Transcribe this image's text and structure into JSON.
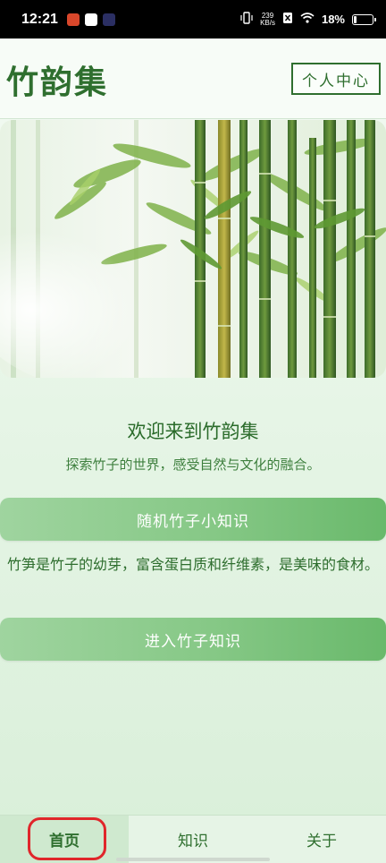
{
  "status_bar": {
    "time": "12:21",
    "net_speed_value": "239",
    "net_speed_unit": "KB/s",
    "battery_text": "18%",
    "battery_level": 0.18
  },
  "header": {
    "title": "竹韵集",
    "profile_button": "个人中心"
  },
  "main": {
    "welcome_title": "欢迎来到竹韵集",
    "welcome_subtitle": "探索竹子的世界，感受自然与文化的融合。",
    "random_fact_button": "随机竹子小知识",
    "fact_text": "竹笋是竹子的幼芽，富含蛋白质和纤维素，是美味的食材。",
    "enter_knowledge_button": "进入竹子知识"
  },
  "bottom_nav": {
    "items": [
      {
        "label": "首页",
        "active": true
      },
      {
        "label": "知识",
        "active": false
      },
      {
        "label": "关于",
        "active": false
      }
    ]
  },
  "colors": {
    "primary_green": "#2f6f2f",
    "button_green": "#86c886",
    "highlight_red": "#e0262b"
  }
}
